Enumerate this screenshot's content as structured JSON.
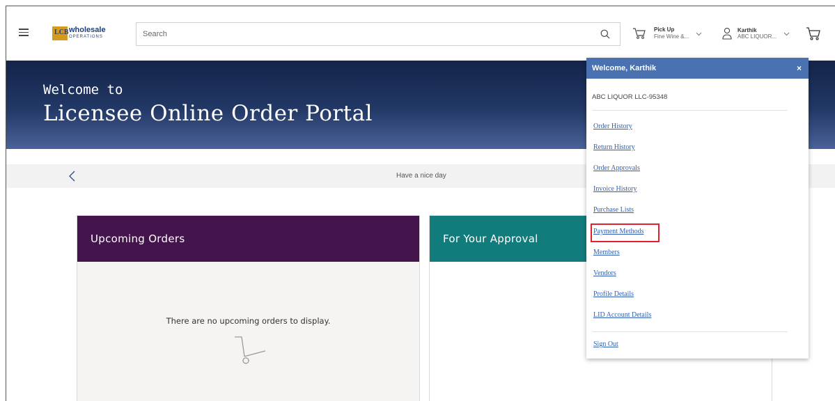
{
  "header": {
    "logo_text": "wholesale",
    "logo_sub": "OPERATIONS",
    "logo_mark": "LCB",
    "search_placeholder": "Search",
    "pickup_title": "Pick Up",
    "pickup_sub": "Fine Wine &...",
    "user_name": "Karthik",
    "user_sub": "ABC LIQUOR..."
  },
  "banner": {
    "line1": "Welcome to",
    "line2": "Licensee Online Order Portal"
  },
  "message_bar": {
    "text": "Have a nice day"
  },
  "cards": {
    "upcoming_title": "Upcoming Orders",
    "upcoming_empty": "There are no upcoming orders to display.",
    "approval_title": "For Your Approval"
  },
  "dropdown": {
    "title": "Welcome, Karthik",
    "close": "×",
    "account": "ABC LIQUOR LLC-95348",
    "links": [
      "Order History",
      "Return History",
      "Order Approvals",
      "Invoice History",
      "Purchase Lists",
      "Payment Methods",
      "Members",
      "Vendors",
      "Profile Details",
      "LID Account Details"
    ],
    "sign_out": "Sign Out"
  },
  "colors": {
    "banner": "#1e3362",
    "upcoming_header": "#44154c",
    "approval_header": "#127b7b",
    "dropdown_header": "#4a72b0",
    "link": "#2f5fb3",
    "highlight": "#e0202a"
  },
  "icons": [
    "hamburger-icon",
    "search-icon",
    "pickup-cart-icon",
    "chevron-down-icon",
    "user-icon",
    "cart-icon",
    "chevron-left-icon",
    "close-icon",
    "trolley-icon"
  ]
}
